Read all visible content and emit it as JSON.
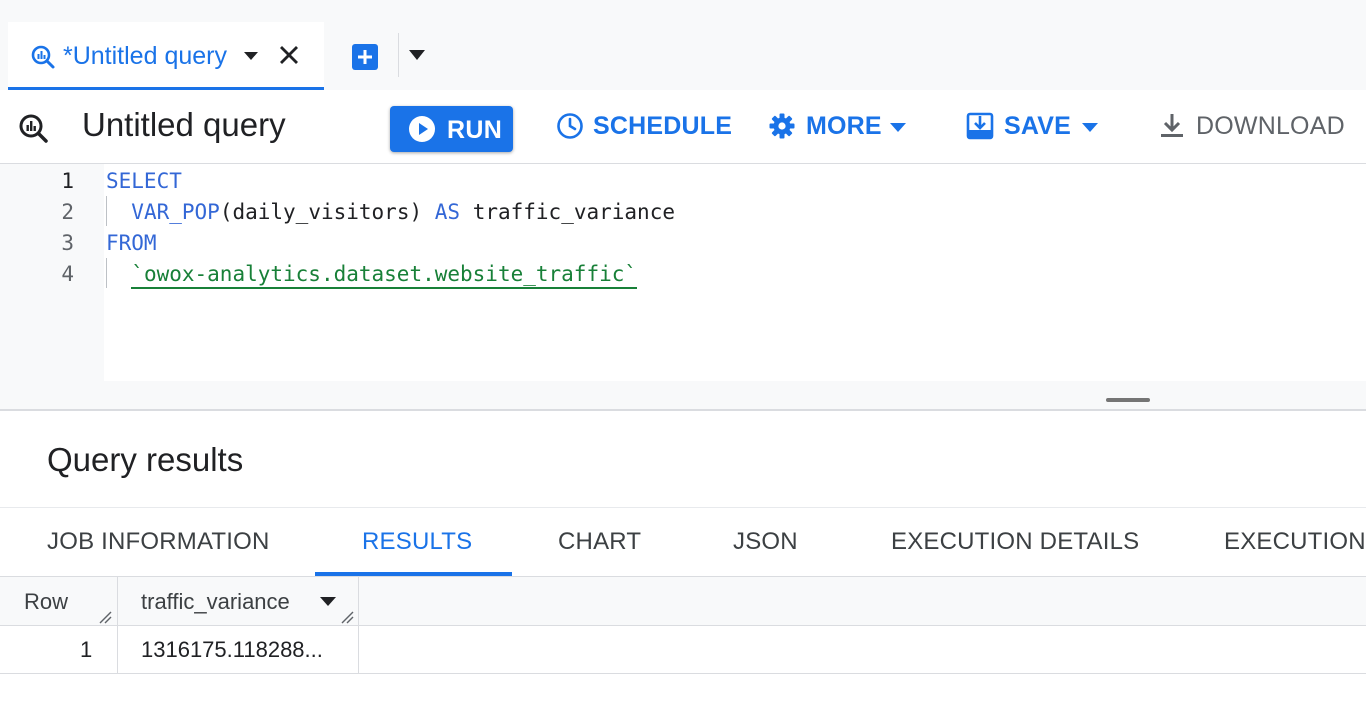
{
  "tabs": [
    {
      "label": "*Untitled query",
      "active": true
    }
  ],
  "toolbar": {
    "query_title": "Untitled query",
    "run_label": "RUN",
    "schedule_label": "SCHEDULE",
    "more_label": "MORE",
    "save_label": "SAVE",
    "download_label": "DOWNLOAD"
  },
  "editor": {
    "lines": [
      {
        "number": "1",
        "keyword": "SELECT",
        "text": ""
      },
      {
        "number": "2",
        "keyword": "VAR_POP",
        "text": "(daily_visitors) ",
        "keyword2": "AS",
        "text2": " traffic_variance"
      },
      {
        "number": "3",
        "keyword": "FROM",
        "text": ""
      },
      {
        "number": "4",
        "string": "`owox-analytics.dataset.website_traffic`"
      }
    ]
  },
  "results": {
    "title": "Query results",
    "tabs": [
      "JOB INFORMATION",
      "RESULTS",
      "CHART",
      "JSON",
      "EXECUTION DETAILS",
      "EXECUTION"
    ],
    "active_tab": "RESULTS",
    "columns": [
      "Row",
      "traffic_variance"
    ],
    "rows": [
      {
        "row": "1",
        "traffic_variance": "1316175.118288..."
      }
    ]
  },
  "colors": {
    "accent": "#1a73e8",
    "keyword": "#3367d6",
    "string": "#188038"
  },
  "icons": {
    "tab": "query-icon",
    "close": "close-icon",
    "new_tab": "add-box-icon",
    "run": "play-circle-icon",
    "schedule": "clock-icon",
    "more": "gear-icon",
    "save": "save-icon",
    "download": "download-icon"
  }
}
